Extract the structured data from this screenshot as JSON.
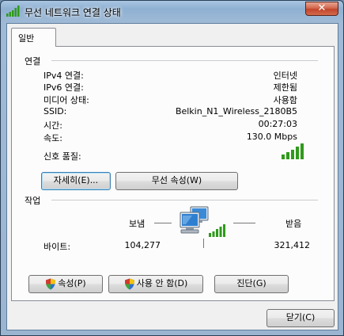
{
  "window": {
    "title": "무선 네트워크 연결 상태",
    "close_glyph": "✕"
  },
  "tabs": [
    {
      "label": "일반"
    }
  ],
  "connection": {
    "title": "연결",
    "rows": [
      {
        "label": "IPv4 연결:",
        "value": "인터넷"
      },
      {
        "label": "IPv6 연결:",
        "value": "제한됨"
      },
      {
        "label": "미디어 상태:",
        "value": "사용함"
      },
      {
        "label": "SSID:",
        "value": "Belkin_N1_Wireless_2180B5"
      },
      {
        "label": "시간:",
        "value": "00:27:03"
      },
      {
        "label": "속도:",
        "value": "130.0 Mbps"
      }
    ],
    "signal_label": "신호 품질:",
    "signal_bars": 5,
    "signal_level": 5,
    "details_button": "자세히(E)...",
    "wireless_props_button": "무선 속성(W)"
  },
  "activity": {
    "title": "작업",
    "sent_label": "보냄",
    "received_label": "받음",
    "bytes_label": "바이트:",
    "bytes_sent": "104,277",
    "bytes_received": "321,412"
  },
  "actions": {
    "properties_button": "속성(P)",
    "disable_button": "사용 안 함(D)",
    "diagnose_button": "진단(G)"
  },
  "footer": {
    "close_button": "닫기(C)"
  },
  "colors": {
    "signal": "#2f9a1b",
    "shield_blue": "#2d6fd0",
    "shield_yellow": "#f2c40e",
    "shield_red": "#d23a2b",
    "shield_green": "#3ea53a"
  }
}
